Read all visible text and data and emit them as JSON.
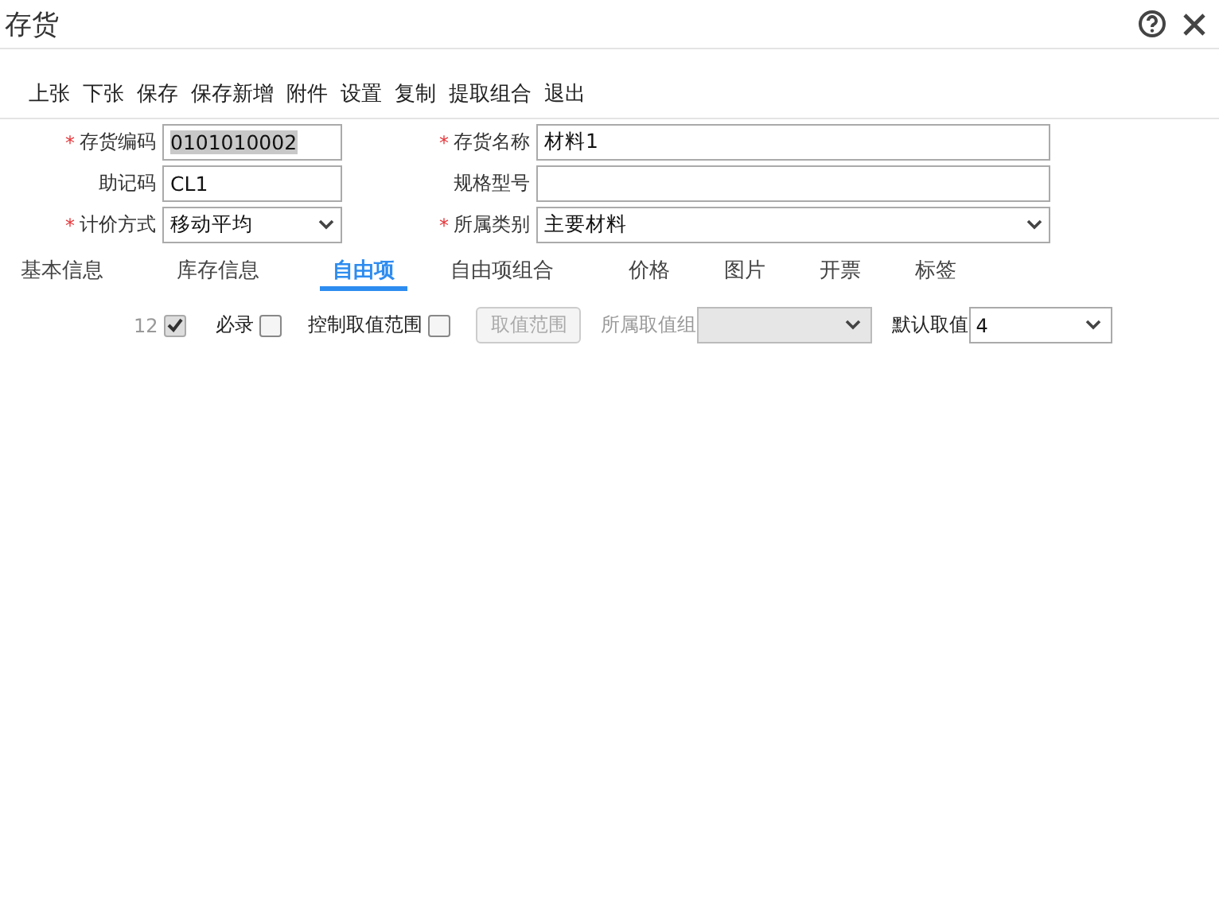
{
  "window": {
    "title": "存货"
  },
  "toolbar": [
    "上张",
    "下张",
    "保存",
    "保存新增",
    "附件",
    "设置",
    "复制",
    "提取组合",
    "退出"
  ],
  "form": [
    {
      "label": "存货编码",
      "required_mark": "*",
      "kind": "text",
      "value": "0101010002",
      "text_selected": true
    },
    {
      "label": "存货名称",
      "required_mark": "*",
      "kind": "text",
      "value": "材料1",
      "text_selected": false
    },
    {
      "label": "助记码",
      "kind": "text",
      "value": "CL1",
      "text_selected": false
    },
    {
      "label": "规格型号",
      "kind": "text"
    },
    {
      "label": "计价方式",
      "required_mark": "*",
      "kind": "select",
      "value": "移动平均"
    },
    {
      "label": "所属类别",
      "required_mark": "*",
      "kind": "select",
      "value": "主要材料"
    }
  ],
  "tabs": [
    {
      "label": "基本信息",
      "selected": false
    },
    {
      "label": "库存信息",
      "selected": false
    },
    {
      "label": "自由项",
      "selected": true
    },
    {
      "label": "自由项组合",
      "selected": false
    },
    {
      "label": "价格",
      "selected": false
    },
    {
      "label": "图片",
      "selected": false
    },
    {
      "label": "开票",
      "selected": false
    },
    {
      "label": "标签",
      "selected": false
    }
  ],
  "options": [
    {
      "kind": "checkbox",
      "label": "12",
      "checked": true,
      "disabled": true
    },
    {
      "kind": "checkbox",
      "label": "必录",
      "checked": false,
      "disabled": false
    },
    {
      "kind": "checkbox",
      "label": "控制取值范围",
      "checked": false,
      "disabled": false
    },
    {
      "kind": "button",
      "label": "取值范围",
      "disabled": true
    },
    {
      "kind": "select",
      "label": "所属取值组",
      "disabled": true
    },
    {
      "kind": "select",
      "label": "默认取值",
      "value": "4",
      "disabled": false
    }
  ]
}
